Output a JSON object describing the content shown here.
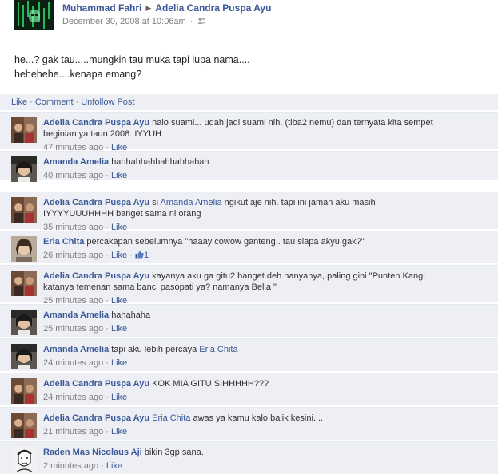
{
  "post": {
    "author": "Muhammad Fahri",
    "target": "Adelia Candra Puspa Ayu",
    "timestamp": "December 30, 2008 at 10:06am",
    "separator": "·",
    "privacy_icon": "friends-icon",
    "text_lines": [
      "he...? gak tau.....mungkin tau muka tapi lupa nama....",
      "hehehehe....kenapa emang?"
    ]
  },
  "actions": {
    "like": "Like",
    "comment": "Comment",
    "unfollow": "Unfollow Post",
    "dot": "·"
  },
  "comments": [
    {
      "name": "Adelia Candra Puspa Ayu",
      "mention": "",
      "lines": [
        "halo suami... udah jadi suami nih. (tiba2 nemu) dan ternyata kita sempet",
        "beginian ya taun 2008. IYYUH"
      ],
      "time": "47 minutes ago",
      "like": "Like",
      "likes": ""
    },
    {
      "name": "Amanda Amelia",
      "mention": "",
      "lines": [
        "hahhahhahhahhahhahah"
      ],
      "time": "40 minutes ago",
      "like": "Like",
      "likes": ""
    },
    {
      "name": "Adelia Candra Puspa Ayu",
      "mention": "",
      "lines": [
        "si",
        "Amanda Amelia",
        "ngikut aje nih. tapi ini jaman aku masih",
        "IYYYYUUUHHHH banget sama ni orang"
      ],
      "time": "35 minutes ago",
      "like": "Like",
      "likes": ""
    },
    {
      "name": "Eria Chita",
      "mention": "",
      "lines": [
        "percakapan sebelumnya \"haaay cowow ganteng.. tau siapa akyu gak?\""
      ],
      "time": "26 minutes ago",
      "like": "Like",
      "likes": "1"
    },
    {
      "name": "Adelia Candra Puspa Ayu",
      "mention": "",
      "lines": [
        "kayanya aku ga gitu2 banget deh nanyanya, paling gini \"Punten Kang,",
        "katanya temenan sama banci pasopati ya? namanya Bella \""
      ],
      "time": "25 minutes ago",
      "like": "Like",
      "likes": ""
    },
    {
      "name": "Amanda Amelia",
      "mention": "",
      "lines": [
        "hahahaha"
      ],
      "time": "25 minutes ago",
      "like": "Like",
      "likes": ""
    },
    {
      "name": "Amanda Amelia",
      "mention": "",
      "lines": [
        "tapi aku lebih percaya",
        "Eria Chita"
      ],
      "time": "24 minutes ago",
      "like": "Like",
      "likes": ""
    },
    {
      "name": "Adelia Candra Puspa Ayu",
      "mention": "",
      "lines": [
        "KOK MIA GITU SIHHHHH???"
      ],
      "time": "24 minutes ago",
      "like": "Like",
      "likes": ""
    },
    {
      "name": "Adelia Candra Puspa Ayu",
      "mention": "",
      "lines": [
        "Eria Chita",
        "awas ya kamu kalo balik kesini...."
      ],
      "time": "21 minutes ago",
      "like": "Like",
      "likes": ""
    },
    {
      "name": "Raden Mas Nicolaus Aji",
      "mention": "",
      "lines": [
        "bikin 3gp sana."
      ],
      "time": "2 minutes ago",
      "like": "Like",
      "likes": ""
    }
  ],
  "colors": {
    "link": "#3b5998",
    "comment_bg": "#edeff4",
    "meta": "#808080"
  }
}
